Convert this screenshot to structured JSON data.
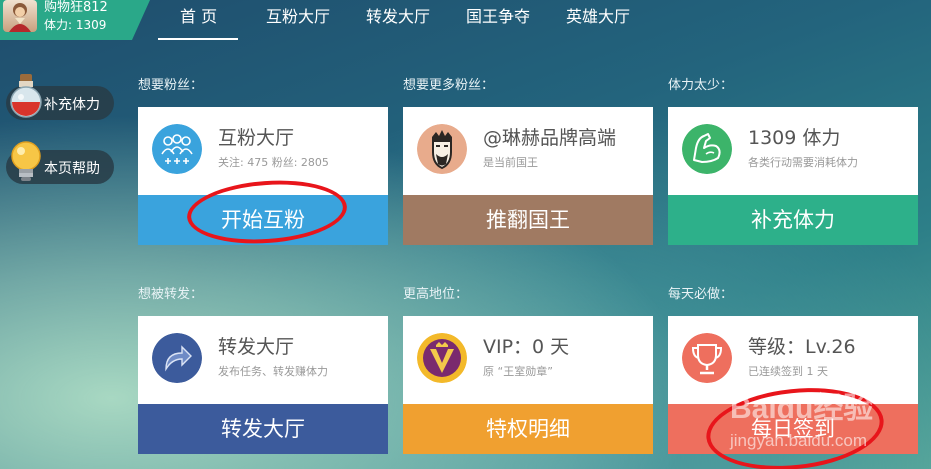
{
  "user": {
    "name": "购物狂812",
    "stamina_label": "体力: 1309"
  },
  "nav": {
    "items": [
      "首 页",
      "互粉大厅",
      "转发大厅",
      "国王争夺",
      "英雄大厅"
    ],
    "active_index": 0
  },
  "side": {
    "recharge_label": "补充体力",
    "help_label": "本页帮助"
  },
  "sections": {
    "s1": "想要粉丝：",
    "s2": "想要更多粉丝：",
    "s3": "体力太少：",
    "s4": "想被转发：",
    "s5": "更高地位：",
    "s6": "每天必做："
  },
  "cards": {
    "fans": {
      "title": "互粉大厅",
      "sub": "关注: 475 粉丝: 2805",
      "action": "开始互粉",
      "icon": "group-icon",
      "color": "#3aa3dd"
    },
    "king": {
      "title": "@琳赫品牌高端",
      "sub": "是当前国王",
      "action": "推翻国王",
      "icon": "king-icon",
      "color": "#a07a62"
    },
    "stamina": {
      "title": "1309 体力",
      "sub": "各类行动需要消耗体力",
      "action": "补充体力",
      "icon": "muscle-arm-icon",
      "color": "#2db08a"
    },
    "forward": {
      "title": "转发大厅",
      "sub": "发布任务、转发赚体力",
      "action": "转发大厅",
      "icon": "share-arrow-icon",
      "color": "#3c5b9c"
    },
    "vip": {
      "title": "VIP：0 天",
      "sub": "原 “王室勋章”",
      "action": "特权明细",
      "icon": "vip-badge-icon",
      "color": "#f0a030"
    },
    "signin": {
      "title": "等级：Lv.26",
      "sub": "已连续签到 1 天",
      "action": "每日签到",
      "icon": "trophy-icon",
      "color": "#ee6f5e"
    }
  },
  "watermark": {
    "logo": "Baidu经验",
    "url": "jingyan.baidu.com"
  }
}
